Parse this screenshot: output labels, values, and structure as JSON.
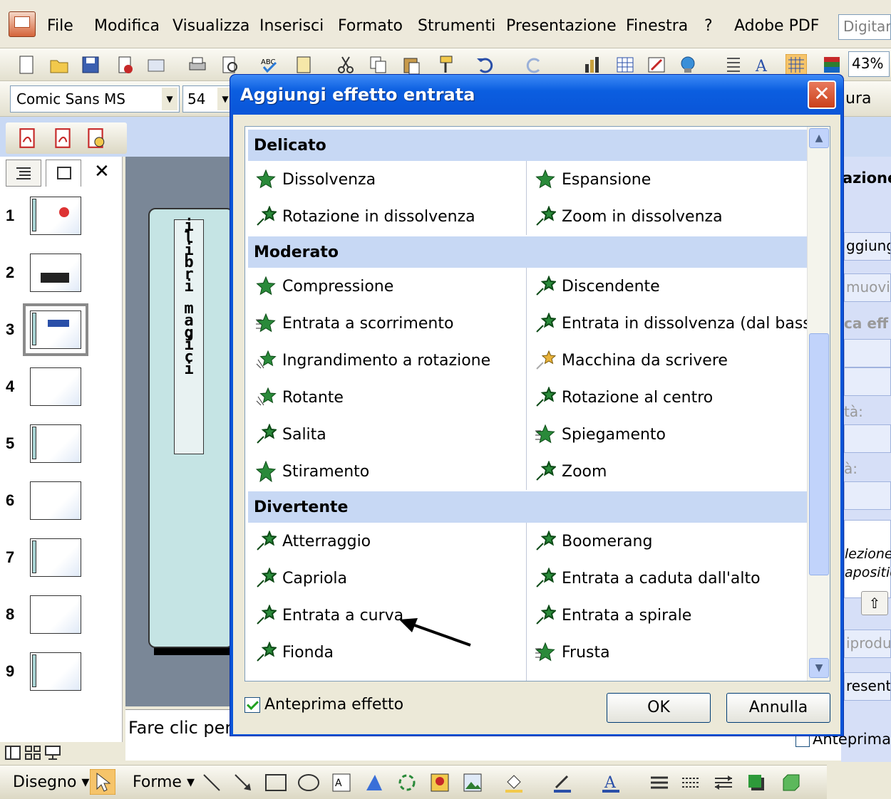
{
  "menubar": {
    "items": [
      "File",
      "Modifica",
      "Visualizza",
      "Inserisci",
      "Formato",
      "Strumenti",
      "Presentazione",
      "Finestra",
      "?",
      "Adobe PDF"
    ],
    "search_placeholder": "Digitare"
  },
  "toolbar": {
    "zoom": "43%",
    "font": "Comic Sans MS",
    "font_size": "54",
    "partial_label": "ura"
  },
  "slides_panel": {
    "numbers": [
      "1",
      "2",
      "3",
      "4",
      "5",
      "6",
      "7",
      "8",
      "9"
    ],
    "selected": "3"
  },
  "slide": {
    "vertical_text": [
      "i",
      "l",
      "i",
      "b",
      "r",
      "i",
      "",
      "m",
      "a",
      "g",
      "i",
      "c",
      "i"
    ]
  },
  "notes": {
    "placeholder": "Fare clic per"
  },
  "task_pane": {
    "title": "azione",
    "field_aggiungi": "ggiung",
    "field_rimuovi": "muovi",
    "label_effetto": "ca eff",
    "label_prop1": "tà:",
    "label_prop2": "à:",
    "hint1": "lezione",
    "hint2": "aposition",
    "field_riproduci": "iprodu",
    "label_presenta": "resenta",
    "anteprima": "Anteprima"
  },
  "bottom_toolbar": {
    "draw": "Disegno ▾",
    "shapes": "Forme ▾"
  },
  "dialog": {
    "title": "Aggiungi effetto entrata",
    "groups": [
      {
        "name": "Delicato",
        "effects": [
          "Dissolvenza",
          "Espansione",
          "Rotazione in dissolvenza",
          "Zoom in dissolvenza"
        ]
      },
      {
        "name": "Moderato",
        "effects": [
          "Compressione",
          "Discendente",
          "Entrata a scorrimento",
          "Entrata in dissolvenza (dal basso)",
          "Ingrandimento a rotazione",
          "Macchina da scrivere",
          "Rotante",
          "Rotazione al centro",
          "Salita",
          "Spiegamento",
          "Stiramento",
          "Zoom"
        ]
      },
      {
        "name": "Divertente",
        "effects": [
          "Atterraggio",
          "Boomerang",
          "Capriola",
          "Entrata a caduta dall'alto",
          "Entrata a curva",
          "Entrata a spirale",
          "Fionda",
          "Frusta"
        ]
      }
    ],
    "preview_label": "Anteprima effetto",
    "ok_label": "OK",
    "cancel_label": "Annulla"
  },
  "colors": {
    "dialog_titlebar": "#0a55d8",
    "group_header": "#c7d8f4",
    "star_green": "#2a8a3a"
  }
}
